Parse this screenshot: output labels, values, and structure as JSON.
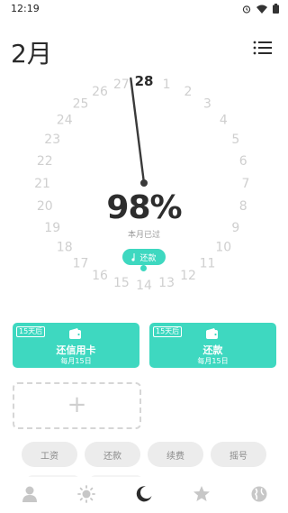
{
  "status": {
    "time": "12:19"
  },
  "header": {
    "month": "2月"
  },
  "dial": {
    "numbers": [
      "1",
      "2",
      "3",
      "4",
      "5",
      "6",
      "7",
      "8",
      "9",
      "10",
      "11",
      "12",
      "13",
      "14",
      "15",
      "16",
      "17",
      "18",
      "19",
      "20",
      "21",
      "22",
      "23",
      "24",
      "25",
      "26",
      "27",
      "28"
    ],
    "current": "28",
    "percent": "98%",
    "caption": "本月已过",
    "needle_fraction": 0.98
  },
  "repay_button": {
    "label": "还款"
  },
  "cards": [
    {
      "badge": "15天后",
      "title": "还信用卡",
      "sub": "每月15日"
    },
    {
      "badge": "15天后",
      "title": "还款",
      "sub": "每月15日"
    }
  ],
  "add_button": {
    "label": "+"
  },
  "chips": [
    "工资",
    "还款",
    "续费",
    "摇号"
  ],
  "colors": {
    "accent": "#3ed8c0",
    "needle": "#3a3a3a",
    "nav_active": "#2c2c2c",
    "nav_inactive": "#c7c7c7"
  },
  "nav": [
    "person-icon",
    "sun-icon",
    "moon-icon",
    "star-icon",
    "globe-icon"
  ]
}
